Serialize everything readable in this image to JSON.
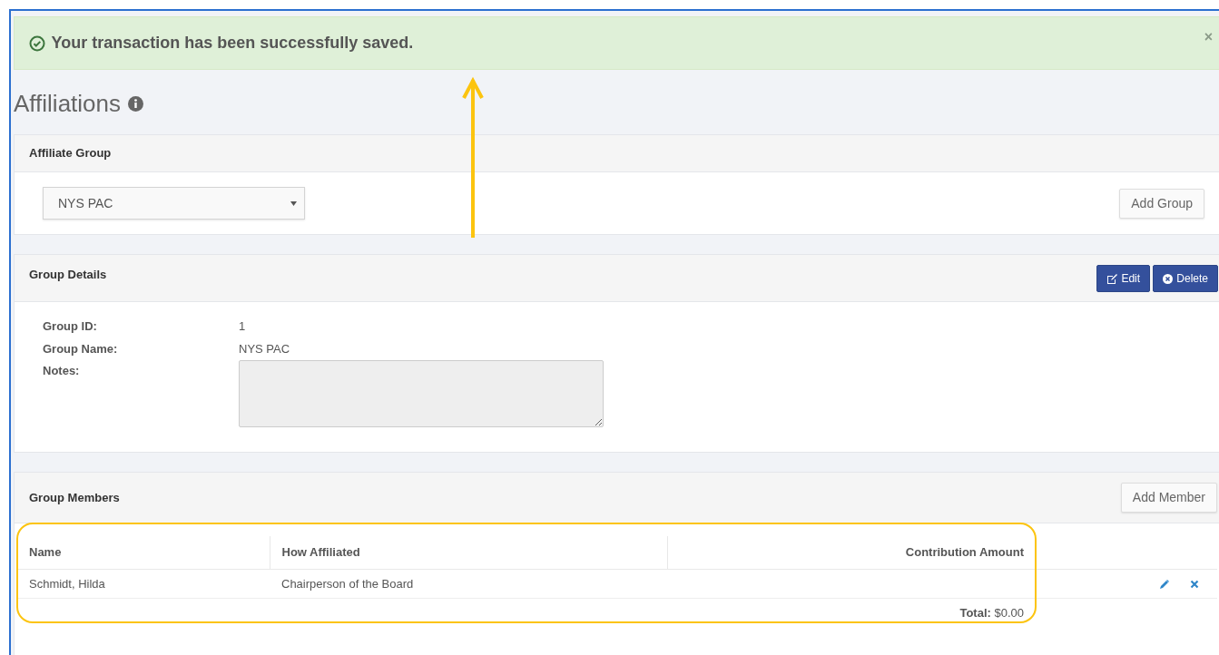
{
  "alert": {
    "message": "Your transaction has been successfully saved.",
    "close_glyph": "×"
  },
  "page_title": "Affiliations",
  "affiliate_group": {
    "heading": "Affiliate Group",
    "select": {
      "value": "NYS PAC"
    },
    "button": "Add Group"
  },
  "group_details": {
    "heading": "Group Details",
    "buttons": [
      {
        "label": "Edit",
        "kind": "edit"
      },
      {
        "label": "Delete",
        "kind": "delete"
      }
    ],
    "fields": [
      {
        "label": "Group ID:",
        "kind": "text",
        "value": "1"
      },
      {
        "label": "Group Name:",
        "kind": "text",
        "value": "NYS PAC"
      },
      {
        "label": "Notes:",
        "kind": "textarea",
        "disabled": true
      }
    ]
  },
  "group_members": {
    "heading": "Group Members",
    "button": "Add Member",
    "table": {
      "columns": [
        "Name",
        "How Affiliated",
        "Contribution Amount"
      ],
      "rows": [
        {
          "name": "Schmidt, Hilda",
          "how_affiliated": "Chairperson of the Board"
        }
      ],
      "total_label": "Total:",
      "total_value": "$0.00"
    }
  }
}
